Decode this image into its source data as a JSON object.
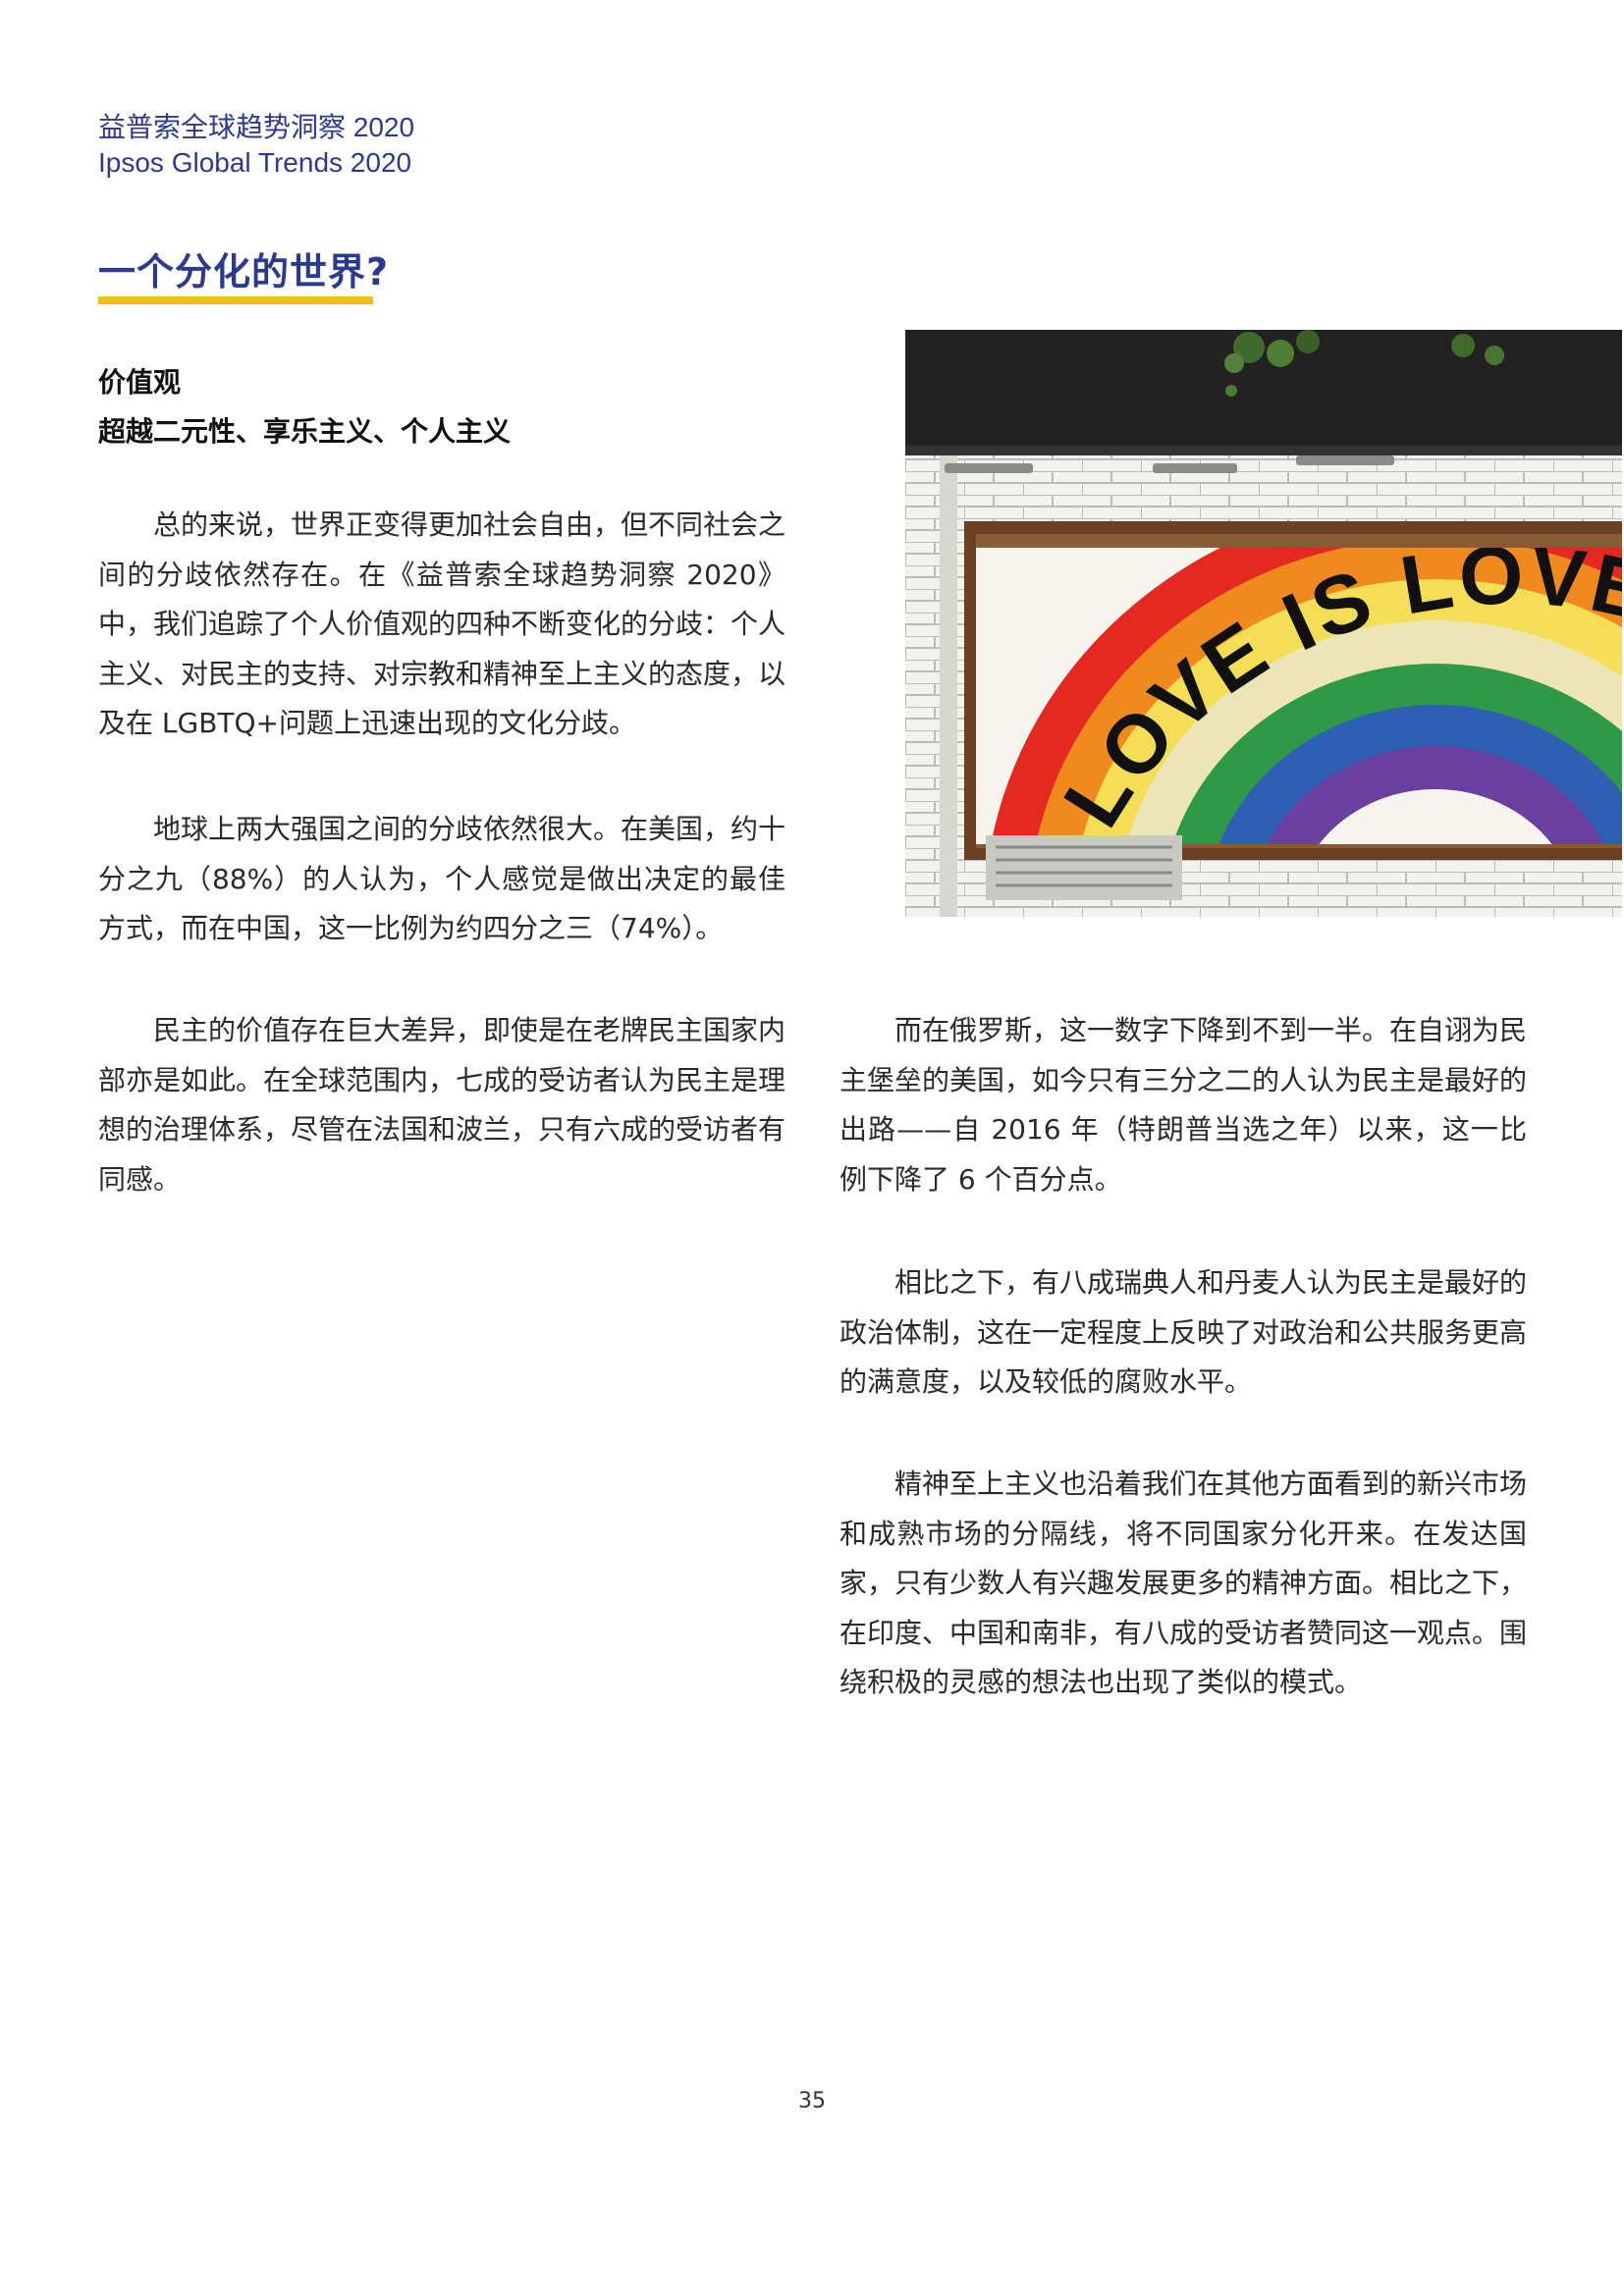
{
  "header": {
    "title_zh": "益普索全球趋势洞察 2020",
    "title_en": "Ipsos Global Trends 2020"
  },
  "section": {
    "title": "一个分化的世界?",
    "subtitle_1": "价值观",
    "subtitle_2": "超越二元性、享乐主义、个人主义"
  },
  "column_left": [
    "总的来说，世界正变得更加社会自由，但不同社会之间的分歧依然存在。在《益普索全球趋势洞察 2020》中，我们追踪了个人价值观的四种不断变化的分歧：个人主义、对民主的支持、对宗教和精神至上主义的态度，以及在 LGBTQ+问题上迅速出现的文化分歧。",
    "地球上两大强国之间的分歧依然很大。在美国，约十分之九（88%）的人认为，个人感觉是做出决定的最佳方式，而在中国，这一比例为约四分之三（74%）。",
    "民主的价值存在巨大差异，即使是在老牌民主国家内部亦是如此。在全球范围内，七成的受访者认为民主是理想的治理体系，尽管在法国和波兰，只有六成的受访者有同感。"
  ],
  "column_right": [
    "而在俄罗斯，这一数字下降到不到一半。在自诩为民主堡垒的美国，如今只有三分之二的人认为民主是最好的出路——自 2016 年（特朗普当选之年）以来，这一比例下降了 6 个百分点。",
    "相比之下，有八成瑞典人和丹麦人认为民主是最好的政治体制，这在一定程度上反映了对政治和公共服务更高的满意度，以及较低的腐败水平。",
    "精神至上主义也沿着我们在其他方面看到的新兴市场和成熟市场的分隔线，将不同国家分化开来。在发达国家，只有少数人有兴趣发展更多的精神方面。相比之下，在印度、中国和南非，有八成的受访者赞同这一观点。围绕积极的灵感的想法也出现了类似的模式。"
  ],
  "photo": {
    "sign_text": "LOVE IS LOVE"
  },
  "page_number": "35",
  "colors": {
    "brand_blue": "#2b3a8c",
    "accent_yellow": "#f2bd16"
  }
}
